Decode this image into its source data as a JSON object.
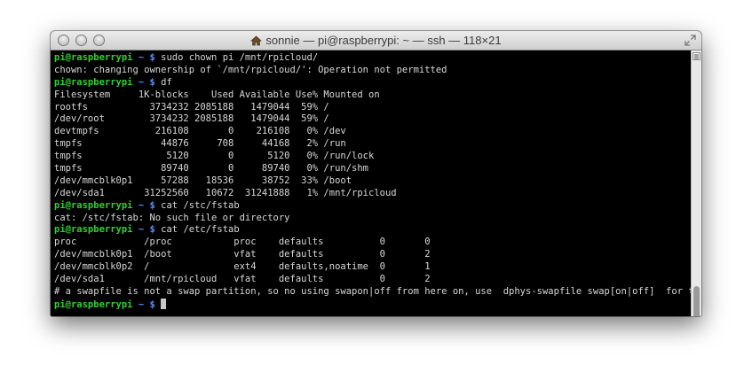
{
  "window": {
    "title": "sonnie — pi@raspberrypi: ~ — ssh — 118×21"
  },
  "terminal": {
    "prompt_user": "pi@raspberrypi",
    "prompt_path": "~",
    "prompt_symbol": "$",
    "lines": [
      {
        "type": "prompt",
        "command": "sudo chown pi /mnt/rpicloud/"
      },
      {
        "type": "output",
        "text": "chown: changing ownership of `/mnt/rpicloud/': Operation not permitted"
      },
      {
        "type": "prompt",
        "command": "df"
      },
      {
        "type": "output",
        "text": "Filesystem     1K-blocks    Used Available Use% Mounted on"
      },
      {
        "type": "output",
        "text": "rootfs           3734232 2085188   1479044  59% /"
      },
      {
        "type": "output",
        "text": "/dev/root        3734232 2085188   1479044  59% /"
      },
      {
        "type": "output",
        "text": "devtmpfs          216108       0    216108   0% /dev"
      },
      {
        "type": "output",
        "text": "tmpfs              44876     708     44168   2% /run"
      },
      {
        "type": "output",
        "text": "tmpfs               5120       0      5120   0% /run/lock"
      },
      {
        "type": "output",
        "text": "tmpfs              89740       0     89740   0% /run/shm"
      },
      {
        "type": "output",
        "text": "/dev/mmcblk0p1     57288   18536     38752  33% /boot"
      },
      {
        "type": "output",
        "text": "/dev/sda1       31252560   10672  31241888   1% /mnt/rpicloud"
      },
      {
        "type": "prompt",
        "command": "cat /stc/fstab"
      },
      {
        "type": "output",
        "text": "cat: /stc/fstab: No such file or directory"
      },
      {
        "type": "prompt",
        "command": "cat /etc/fstab"
      },
      {
        "type": "output",
        "text": "proc            /proc           proc    defaults          0       0"
      },
      {
        "type": "output",
        "text": "/dev/mmcblk0p1  /boot           vfat    defaults          0       2"
      },
      {
        "type": "output",
        "text": "/dev/mmcblk0p2  /               ext4    defaults,noatime  0       1"
      },
      {
        "type": "output",
        "text": "/dev/sda1       /mnt/rpicloud   vfat    defaults          0       2"
      },
      {
        "type": "output",
        "text": "# a swapfile is not a swap partition, so no using swapon|off from here on, use  dphys-swapfile swap[on|off]  for that"
      },
      {
        "type": "prompt",
        "command": "",
        "cursor": true
      }
    ]
  },
  "colors": {
    "background": "#000000",
    "text": "#d8d8d8",
    "prompt_user": "#2fd12f",
    "prompt_path": "#5b8cff"
  },
  "icons": {
    "title_icon": "house-icon",
    "resize_icon": "fullscreen-icon"
  }
}
